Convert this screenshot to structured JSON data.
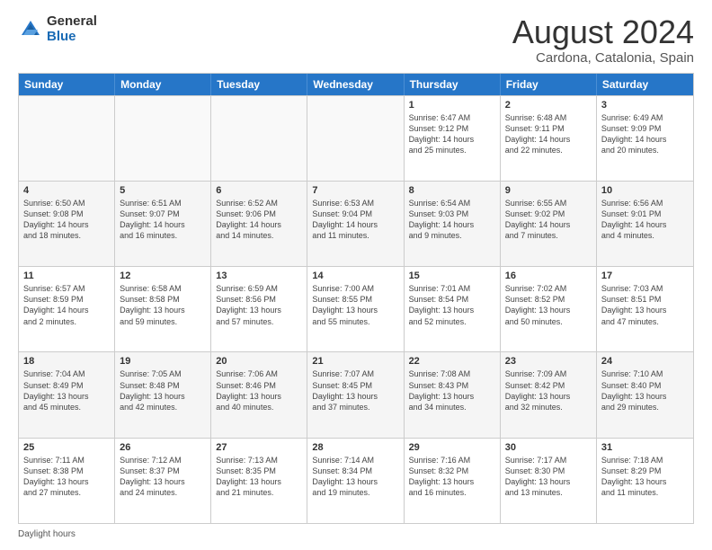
{
  "logo": {
    "general": "General",
    "blue": "Blue"
  },
  "title": "August 2024",
  "subtitle": "Cardona, Catalonia, Spain",
  "days": [
    "Sunday",
    "Monday",
    "Tuesday",
    "Wednesday",
    "Thursday",
    "Friday",
    "Saturday"
  ],
  "footer_label": "Daylight hours",
  "rows": [
    [
      {
        "num": "",
        "text": "",
        "empty": true
      },
      {
        "num": "",
        "text": "",
        "empty": true
      },
      {
        "num": "",
        "text": "",
        "empty": true
      },
      {
        "num": "",
        "text": "",
        "empty": true
      },
      {
        "num": "1",
        "text": "Sunrise: 6:47 AM\nSunset: 9:12 PM\nDaylight: 14 hours\nand 25 minutes."
      },
      {
        "num": "2",
        "text": "Sunrise: 6:48 AM\nSunset: 9:11 PM\nDaylight: 14 hours\nand 22 minutes."
      },
      {
        "num": "3",
        "text": "Sunrise: 6:49 AM\nSunset: 9:09 PM\nDaylight: 14 hours\nand 20 minutes."
      }
    ],
    [
      {
        "num": "4",
        "text": "Sunrise: 6:50 AM\nSunset: 9:08 PM\nDaylight: 14 hours\nand 18 minutes."
      },
      {
        "num": "5",
        "text": "Sunrise: 6:51 AM\nSunset: 9:07 PM\nDaylight: 14 hours\nand 16 minutes."
      },
      {
        "num": "6",
        "text": "Sunrise: 6:52 AM\nSunset: 9:06 PM\nDaylight: 14 hours\nand 14 minutes."
      },
      {
        "num": "7",
        "text": "Sunrise: 6:53 AM\nSunset: 9:04 PM\nDaylight: 14 hours\nand 11 minutes."
      },
      {
        "num": "8",
        "text": "Sunrise: 6:54 AM\nSunset: 9:03 PM\nDaylight: 14 hours\nand 9 minutes."
      },
      {
        "num": "9",
        "text": "Sunrise: 6:55 AM\nSunset: 9:02 PM\nDaylight: 14 hours\nand 7 minutes."
      },
      {
        "num": "10",
        "text": "Sunrise: 6:56 AM\nSunset: 9:01 PM\nDaylight: 14 hours\nand 4 minutes."
      }
    ],
    [
      {
        "num": "11",
        "text": "Sunrise: 6:57 AM\nSunset: 8:59 PM\nDaylight: 14 hours\nand 2 minutes."
      },
      {
        "num": "12",
        "text": "Sunrise: 6:58 AM\nSunset: 8:58 PM\nDaylight: 13 hours\nand 59 minutes."
      },
      {
        "num": "13",
        "text": "Sunrise: 6:59 AM\nSunset: 8:56 PM\nDaylight: 13 hours\nand 57 minutes."
      },
      {
        "num": "14",
        "text": "Sunrise: 7:00 AM\nSunset: 8:55 PM\nDaylight: 13 hours\nand 55 minutes."
      },
      {
        "num": "15",
        "text": "Sunrise: 7:01 AM\nSunset: 8:54 PM\nDaylight: 13 hours\nand 52 minutes."
      },
      {
        "num": "16",
        "text": "Sunrise: 7:02 AM\nSunset: 8:52 PM\nDaylight: 13 hours\nand 50 minutes."
      },
      {
        "num": "17",
        "text": "Sunrise: 7:03 AM\nSunset: 8:51 PM\nDaylight: 13 hours\nand 47 minutes."
      }
    ],
    [
      {
        "num": "18",
        "text": "Sunrise: 7:04 AM\nSunset: 8:49 PM\nDaylight: 13 hours\nand 45 minutes."
      },
      {
        "num": "19",
        "text": "Sunrise: 7:05 AM\nSunset: 8:48 PM\nDaylight: 13 hours\nand 42 minutes."
      },
      {
        "num": "20",
        "text": "Sunrise: 7:06 AM\nSunset: 8:46 PM\nDaylight: 13 hours\nand 40 minutes."
      },
      {
        "num": "21",
        "text": "Sunrise: 7:07 AM\nSunset: 8:45 PM\nDaylight: 13 hours\nand 37 minutes."
      },
      {
        "num": "22",
        "text": "Sunrise: 7:08 AM\nSunset: 8:43 PM\nDaylight: 13 hours\nand 34 minutes."
      },
      {
        "num": "23",
        "text": "Sunrise: 7:09 AM\nSunset: 8:42 PM\nDaylight: 13 hours\nand 32 minutes."
      },
      {
        "num": "24",
        "text": "Sunrise: 7:10 AM\nSunset: 8:40 PM\nDaylight: 13 hours\nand 29 minutes."
      }
    ],
    [
      {
        "num": "25",
        "text": "Sunrise: 7:11 AM\nSunset: 8:38 PM\nDaylight: 13 hours\nand 27 minutes."
      },
      {
        "num": "26",
        "text": "Sunrise: 7:12 AM\nSunset: 8:37 PM\nDaylight: 13 hours\nand 24 minutes."
      },
      {
        "num": "27",
        "text": "Sunrise: 7:13 AM\nSunset: 8:35 PM\nDaylight: 13 hours\nand 21 minutes."
      },
      {
        "num": "28",
        "text": "Sunrise: 7:14 AM\nSunset: 8:34 PM\nDaylight: 13 hours\nand 19 minutes."
      },
      {
        "num": "29",
        "text": "Sunrise: 7:16 AM\nSunset: 8:32 PM\nDaylight: 13 hours\nand 16 minutes."
      },
      {
        "num": "30",
        "text": "Sunrise: 7:17 AM\nSunset: 8:30 PM\nDaylight: 13 hours\nand 13 minutes."
      },
      {
        "num": "31",
        "text": "Sunrise: 7:18 AM\nSunset: 8:29 PM\nDaylight: 13 hours\nand 11 minutes."
      }
    ]
  ]
}
